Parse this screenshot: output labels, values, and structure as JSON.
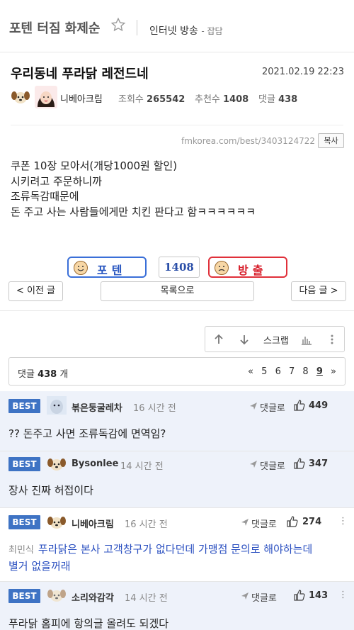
{
  "header": {
    "board_title": "포텐 터짐 화제순",
    "category": "인터넷 방송",
    "subcategory": "- 잡담"
  },
  "post": {
    "title": "우리동네 푸라닭 레전드네",
    "date": "2021.02.19 22:23",
    "author": "니베아크림",
    "views_label": "조회수",
    "views": "265542",
    "rec_label": "추천수",
    "rec": "1408",
    "cm_label": "댓글",
    "cm": "438",
    "source_url": "fmkorea.com/best/3403124722",
    "copy_label": "복사",
    "content": [
      "쿠폰 10장 모아서(개당1000원 할인)",
      "시키려고 주문하니까",
      "조류독감때문에",
      "돈 주고 사는 사람들에게만 치킨 판다고 함ㅋㅋㅋㅋㅋㅋ"
    ]
  },
  "vote": {
    "up_label": "포텐",
    "count": "1408",
    "down_label": "방출"
  },
  "nav": {
    "prev": "< 이전 글",
    "list": "목록으로",
    "next": "다음 글 >"
  },
  "tools": {
    "scrap": "스크랩"
  },
  "comments_header": {
    "label": "댓글",
    "count": "438",
    "unit": "개",
    "pages": [
      "«",
      "5",
      "6",
      "7",
      "8",
      "9",
      "»"
    ],
    "current_page": "9"
  },
  "comments": [
    {
      "badge": "BEST",
      "name": "볶은둥굴레차",
      "time": "16 시간 전",
      "reply": "댓글로",
      "likes": "449",
      "text": "?? 돈주고 사면 조류독감에 면역임?"
    },
    {
      "badge": "BEST",
      "name": "Bysonlee",
      "time": "14 시간 전",
      "reply": "댓글로",
      "likes": "347",
      "text": "장사 진짜 허접이다"
    },
    {
      "badge": "BEST",
      "name": "니베아크림",
      "time": "16 시간 전",
      "reply": "댓글로",
      "likes": "274",
      "kebab": "⋮",
      "mention": "최민식",
      "text1": "푸라닭은 본사 고객창구가 없다던데 가맹점 문의로 해야하는데",
      "text2": "별거 없을꺼래"
    },
    {
      "badge": "BEST",
      "name": "소리와감각",
      "time": "14 시간 전",
      "reply": "댓글로",
      "likes": "143",
      "kebab": "⋮",
      "text": "푸라닭 홈피에 항의글 올려도 되겠다"
    }
  ],
  "colors": {
    "best_badge": "#3e73c4",
    "best_bg": "#eef2fa",
    "vote_up": "#3a6fd8",
    "vote_down": "#e0303a",
    "reply_text": "#2a4fc0"
  }
}
